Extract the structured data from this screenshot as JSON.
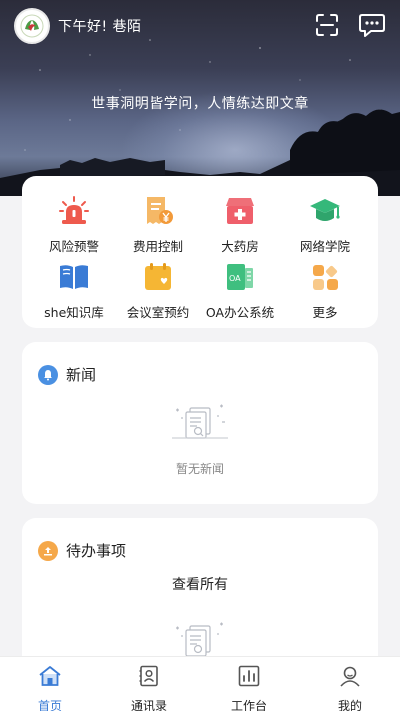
{
  "header": {
    "greeting": "下午好! 巷陌",
    "motto": "世事洞明皆学问，人情练达即文章"
  },
  "icons": {
    "scan": "scan-icon",
    "message": "message-icon",
    "avatar": "logo-avatar"
  },
  "menu": {
    "items": [
      {
        "label": "风险预警",
        "icon": "alarm-light-icon",
        "color": "#ee5a4d"
      },
      {
        "label": "费用控制",
        "icon": "receipt-yen-icon",
        "color": "#f5a84a"
      },
      {
        "label": "大药房",
        "icon": "pharmacy-icon",
        "color": "#ef5f6b"
      },
      {
        "label": "网络学院",
        "icon": "graduation-cap-icon",
        "color": "#35b87a"
      },
      {
        "label": "she知识库",
        "icon": "book-icon",
        "color": "#3a7bd5"
      },
      {
        "label": "会议室预约",
        "icon": "calendar-heart-icon",
        "color": "#f5b634"
      },
      {
        "label": "OA办公系统",
        "icon": "oa-document-icon",
        "color": "#3fbf7f"
      },
      {
        "label": "更多",
        "icon": "more-grid-icon",
        "color": "#f5a84a"
      }
    ]
  },
  "news": {
    "title": "新闻",
    "empty_text": "暂无新闻",
    "accent": "#4a90e2"
  },
  "todo": {
    "title": "待办事项",
    "view_all": "查看所有",
    "accent": "#f5a84a"
  },
  "tabbar": {
    "items": [
      {
        "label": "首页",
        "icon": "home-icon",
        "active": true
      },
      {
        "label": "通讯录",
        "icon": "contacts-icon",
        "active": false
      },
      {
        "label": "工作台",
        "icon": "workbench-chart-icon",
        "active": false
      },
      {
        "label": "我的",
        "icon": "profile-icon",
        "active": false
      }
    ],
    "active_color": "#3a7bd5"
  }
}
